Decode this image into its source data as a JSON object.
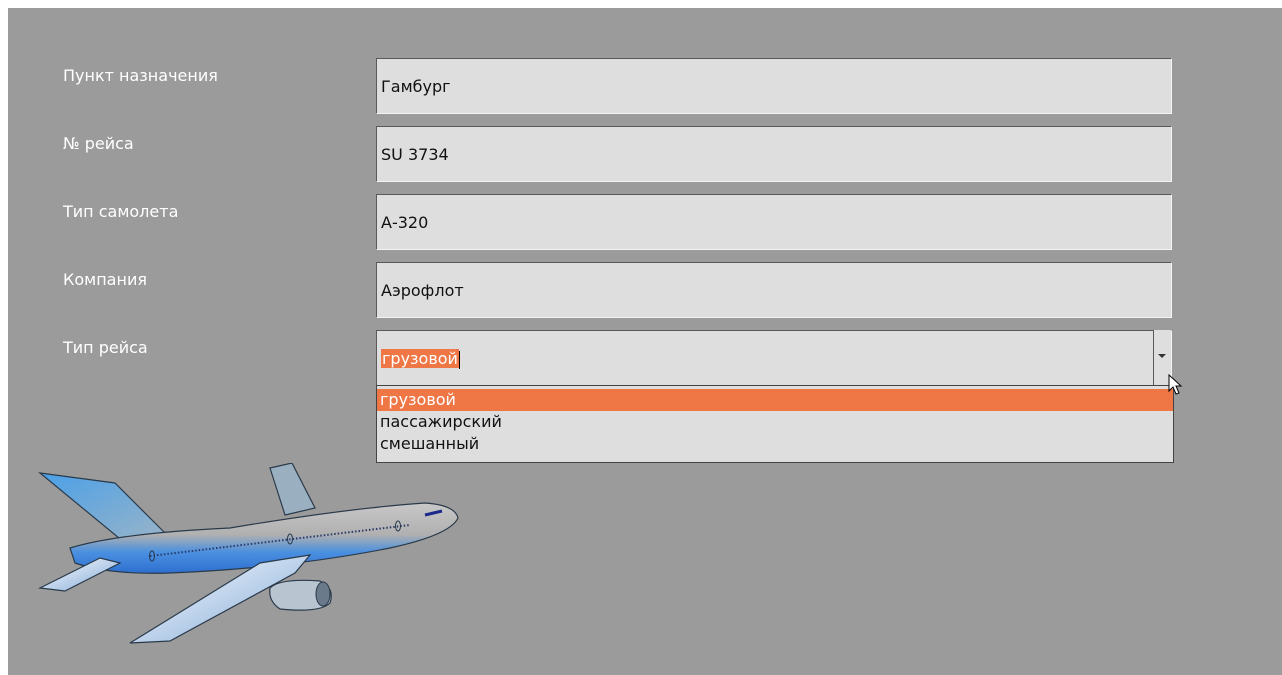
{
  "form": {
    "destination": {
      "label": "Пункт назначения",
      "value": "Гамбург"
    },
    "flight_number": {
      "label": "№ рейса",
      "value": "SU 3734"
    },
    "aircraft_type": {
      "label": "Тип самолета",
      "value": "А-320"
    },
    "company": {
      "label": "Компания",
      "value": "Аэрофлот"
    },
    "flight_type": {
      "label": "Тип рейса",
      "value": "грузовой",
      "options": [
        "грузовой",
        "пассажирский",
        "смешанный"
      ]
    }
  },
  "colors": {
    "panel_bg": "#9b9b9b",
    "field_bg": "#dedede",
    "highlight": "#ef7746"
  },
  "icons": {
    "plane": "airplane-illustration",
    "cursor": "mouse-pointer-icon",
    "dropdown_arrow": "chevron-down-icon"
  }
}
